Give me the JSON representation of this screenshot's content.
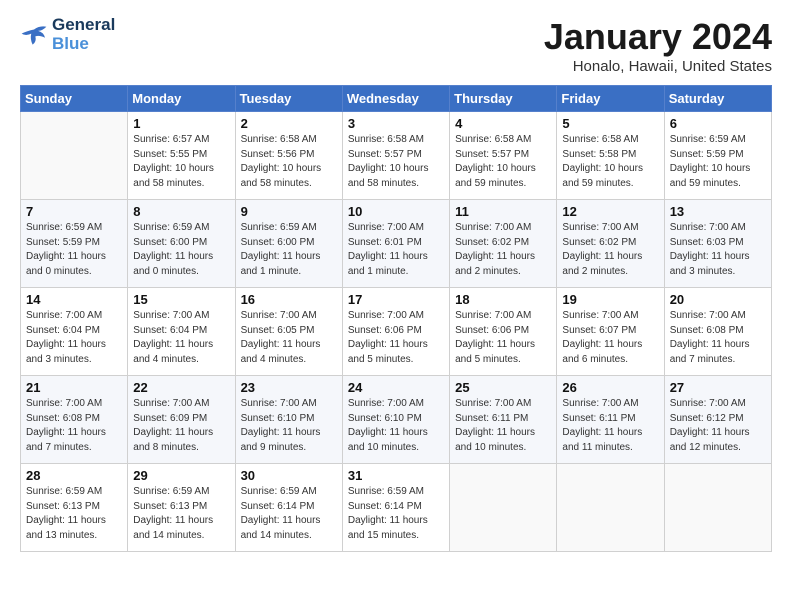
{
  "header": {
    "logo_line1": "General",
    "logo_line2": "Blue",
    "title": "January 2024",
    "subtitle": "Honalo, Hawaii, United States"
  },
  "weekdays": [
    "Sunday",
    "Monday",
    "Tuesday",
    "Wednesday",
    "Thursday",
    "Friday",
    "Saturday"
  ],
  "weeks": [
    [
      {
        "day": null,
        "info": null
      },
      {
        "day": "1",
        "info": "Sunrise: 6:57 AM\nSunset: 5:55 PM\nDaylight: 10 hours\nand 58 minutes."
      },
      {
        "day": "2",
        "info": "Sunrise: 6:58 AM\nSunset: 5:56 PM\nDaylight: 10 hours\nand 58 minutes."
      },
      {
        "day": "3",
        "info": "Sunrise: 6:58 AM\nSunset: 5:57 PM\nDaylight: 10 hours\nand 58 minutes."
      },
      {
        "day": "4",
        "info": "Sunrise: 6:58 AM\nSunset: 5:57 PM\nDaylight: 10 hours\nand 59 minutes."
      },
      {
        "day": "5",
        "info": "Sunrise: 6:58 AM\nSunset: 5:58 PM\nDaylight: 10 hours\nand 59 minutes."
      },
      {
        "day": "6",
        "info": "Sunrise: 6:59 AM\nSunset: 5:59 PM\nDaylight: 10 hours\nand 59 minutes."
      }
    ],
    [
      {
        "day": "7",
        "info": "Sunrise: 6:59 AM\nSunset: 5:59 PM\nDaylight: 11 hours\nand 0 minutes."
      },
      {
        "day": "8",
        "info": "Sunrise: 6:59 AM\nSunset: 6:00 PM\nDaylight: 11 hours\nand 0 minutes."
      },
      {
        "day": "9",
        "info": "Sunrise: 6:59 AM\nSunset: 6:00 PM\nDaylight: 11 hours\nand 1 minute."
      },
      {
        "day": "10",
        "info": "Sunrise: 7:00 AM\nSunset: 6:01 PM\nDaylight: 11 hours\nand 1 minute."
      },
      {
        "day": "11",
        "info": "Sunrise: 7:00 AM\nSunset: 6:02 PM\nDaylight: 11 hours\nand 2 minutes."
      },
      {
        "day": "12",
        "info": "Sunrise: 7:00 AM\nSunset: 6:02 PM\nDaylight: 11 hours\nand 2 minutes."
      },
      {
        "day": "13",
        "info": "Sunrise: 7:00 AM\nSunset: 6:03 PM\nDaylight: 11 hours\nand 3 minutes."
      }
    ],
    [
      {
        "day": "14",
        "info": "Sunrise: 7:00 AM\nSunset: 6:04 PM\nDaylight: 11 hours\nand 3 minutes."
      },
      {
        "day": "15",
        "info": "Sunrise: 7:00 AM\nSunset: 6:04 PM\nDaylight: 11 hours\nand 4 minutes."
      },
      {
        "day": "16",
        "info": "Sunrise: 7:00 AM\nSunset: 6:05 PM\nDaylight: 11 hours\nand 4 minutes."
      },
      {
        "day": "17",
        "info": "Sunrise: 7:00 AM\nSunset: 6:06 PM\nDaylight: 11 hours\nand 5 minutes."
      },
      {
        "day": "18",
        "info": "Sunrise: 7:00 AM\nSunset: 6:06 PM\nDaylight: 11 hours\nand 5 minutes."
      },
      {
        "day": "19",
        "info": "Sunrise: 7:00 AM\nSunset: 6:07 PM\nDaylight: 11 hours\nand 6 minutes."
      },
      {
        "day": "20",
        "info": "Sunrise: 7:00 AM\nSunset: 6:08 PM\nDaylight: 11 hours\nand 7 minutes."
      }
    ],
    [
      {
        "day": "21",
        "info": "Sunrise: 7:00 AM\nSunset: 6:08 PM\nDaylight: 11 hours\nand 7 minutes."
      },
      {
        "day": "22",
        "info": "Sunrise: 7:00 AM\nSunset: 6:09 PM\nDaylight: 11 hours\nand 8 minutes."
      },
      {
        "day": "23",
        "info": "Sunrise: 7:00 AM\nSunset: 6:10 PM\nDaylight: 11 hours\nand 9 minutes."
      },
      {
        "day": "24",
        "info": "Sunrise: 7:00 AM\nSunset: 6:10 PM\nDaylight: 11 hours\nand 10 minutes."
      },
      {
        "day": "25",
        "info": "Sunrise: 7:00 AM\nSunset: 6:11 PM\nDaylight: 11 hours\nand 10 minutes."
      },
      {
        "day": "26",
        "info": "Sunrise: 7:00 AM\nSunset: 6:11 PM\nDaylight: 11 hours\nand 11 minutes."
      },
      {
        "day": "27",
        "info": "Sunrise: 7:00 AM\nSunset: 6:12 PM\nDaylight: 11 hours\nand 12 minutes."
      }
    ],
    [
      {
        "day": "28",
        "info": "Sunrise: 6:59 AM\nSunset: 6:13 PM\nDaylight: 11 hours\nand 13 minutes."
      },
      {
        "day": "29",
        "info": "Sunrise: 6:59 AM\nSunset: 6:13 PM\nDaylight: 11 hours\nand 14 minutes."
      },
      {
        "day": "30",
        "info": "Sunrise: 6:59 AM\nSunset: 6:14 PM\nDaylight: 11 hours\nand 14 minutes."
      },
      {
        "day": "31",
        "info": "Sunrise: 6:59 AM\nSunset: 6:14 PM\nDaylight: 11 hours\nand 15 minutes."
      },
      {
        "day": null,
        "info": null
      },
      {
        "day": null,
        "info": null
      },
      {
        "day": null,
        "info": null
      }
    ]
  ]
}
